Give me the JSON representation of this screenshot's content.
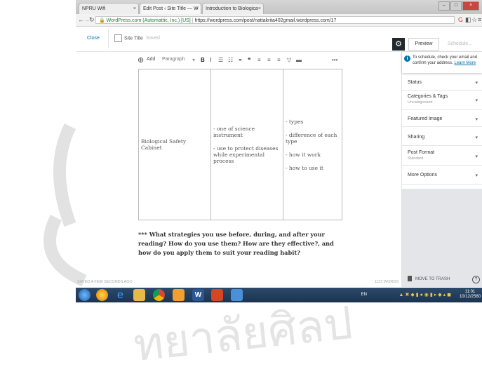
{
  "browser": {
    "tabs": [
      {
        "label": "NPRU Wifi",
        "active": false
      },
      {
        "label": "Edit Post ‹ Site Title — W",
        "active": true
      },
      {
        "label": "Introduction to Biologica",
        "active": false
      }
    ],
    "url_secure_label": "WordPress.com (Automattic, Inc.) [US]",
    "url": "https://wordpress.com/post/nattakrita402gmail.wordpress.com/17"
  },
  "wp_bar": {
    "close_label": "Close",
    "site_title": "Site Title",
    "save_status": "Saved",
    "preview_label": "Preview",
    "schedule_label": "Schedule..."
  },
  "block_toolbar": {
    "add_label": "Add",
    "block_type": "Paragraph",
    "more": "•••"
  },
  "table": {
    "col1": "Biological Safety Cabinet",
    "col2": [
      "- one of science instrument",
      "- use to protect diseases while experimental process"
    ],
    "col3": [
      "- types",
      "- difference of each type",
      "- how it work",
      "- how to use it"
    ]
  },
  "paragraph": "*** What strategies you use before, during, and after your reading? How do you use them? How are they effective?, and how do you apply them to suit your reading habit?",
  "sidebar": {
    "notice_text": "To schedule, check your email and confirm your address.",
    "notice_link": "Learn More",
    "panels": [
      {
        "title": "Status",
        "subtitle": ""
      },
      {
        "title": "Categories & Tags",
        "subtitle": "Uncategorized"
      },
      {
        "title": "Featured Image",
        "subtitle": ""
      },
      {
        "title": "Sharing",
        "subtitle": ""
      },
      {
        "title": "Post Format",
        "subtitle": "Standard"
      },
      {
        "title": "More Options",
        "subtitle": ""
      }
    ],
    "trash_label": "MOVE TO TRASH"
  },
  "footer": {
    "saved_text": "SAVED A FEW SECONDS AGO",
    "word_count": "1123 WORDS"
  },
  "taskbar": {
    "language": "EN",
    "time": "11:01",
    "date": "10/12/2560"
  },
  "colors": {
    "wp_blue": "#0073aa",
    "taskbar": "#1b3350",
    "sidebar_grey": "#e3e5e8"
  }
}
